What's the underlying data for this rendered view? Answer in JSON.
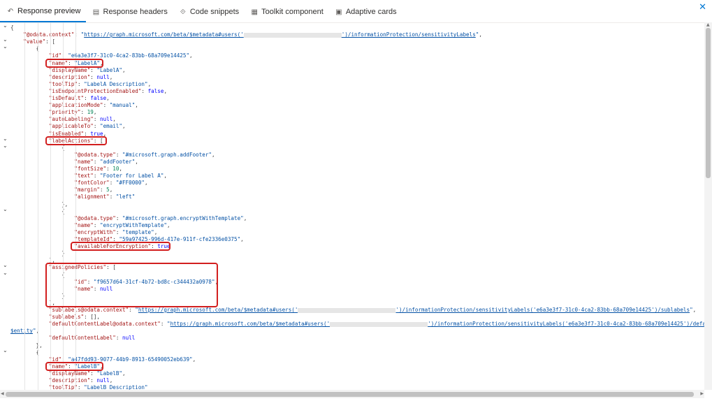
{
  "tabs": [
    {
      "label": "Response preview",
      "icon": "undo-arrow-icon"
    },
    {
      "label": "Response headers",
      "icon": "document-icon"
    },
    {
      "label": "Code snippets",
      "icon": "code-icon"
    },
    {
      "label": "Toolkit component",
      "icon": "toolkit-icon"
    },
    {
      "label": "Adaptive cards",
      "icon": "card-icon"
    }
  ],
  "close_glyph": "✕",
  "lines": [
    {
      "i": 0,
      "t": "{"
    },
    {
      "i": 4,
      "t": "\"@odata.context\": \"https://graph.microsoft.com/beta/$metadata#users('████████████████████')/informationProtection/sensitivityLabels\","
    },
    {
      "i": 4,
      "t": "\"value\": ["
    },
    {
      "i": 8,
      "t": "{"
    },
    {
      "i": 12,
      "t": "\"id\": \"e6a3e3f7-31c0-4ca2-83bb-68a709e14425\","
    },
    {
      "i": 12,
      "t": "\"name\": \"LabelA\","
    },
    {
      "i": 12,
      "t": "\"displayName\": \"LabelA\","
    },
    {
      "i": 12,
      "t": "\"description\": null,"
    },
    {
      "i": 12,
      "t": "\"toolTip\": \"LabelA Description\","
    },
    {
      "i": 12,
      "t": "\"isEndpointProtectionEnabled\": false,"
    },
    {
      "i": 12,
      "t": "\"isDefault\": false,"
    },
    {
      "i": 12,
      "t": "\"applicationMode\": \"manual\","
    },
    {
      "i": 12,
      "t": "\"priority\": 19,"
    },
    {
      "i": 12,
      "t": "\"autoLabeling\": null,"
    },
    {
      "i": 12,
      "t": "\"applicableTo\": \"email\","
    },
    {
      "i": 12,
      "t": "\"isEnabled\": true,"
    },
    {
      "i": 12,
      "t": "\"labelActions\": ["
    },
    {
      "i": 16,
      "t": "{"
    },
    {
      "i": 20,
      "t": "\"@odata.type\": \"#microsoft.graph.addFooter\","
    },
    {
      "i": 20,
      "t": "\"name\": \"addFooter\","
    },
    {
      "i": 20,
      "t": "\"fontSize\": 10,"
    },
    {
      "i": 20,
      "t": "\"text\": \"Footer for Label A\","
    },
    {
      "i": 20,
      "t": "\"fontColor\": \"#FF0000\","
    },
    {
      "i": 20,
      "t": "\"margin\": 5,"
    },
    {
      "i": 20,
      "t": "\"alignment\": \"left\""
    },
    {
      "i": 16,
      "t": "},"
    },
    {
      "i": 16,
      "t": "{"
    },
    {
      "i": 20,
      "t": "\"@odata.type\": \"#microsoft.graph.encryptWithTemplate\","
    },
    {
      "i": 20,
      "t": "\"name\": \"encryptWithTemplate\","
    },
    {
      "i": 20,
      "t": "\"encryptWith\": \"template\","
    },
    {
      "i": 20,
      "t": "\"templateId\": \"59a97425-996d-417e-911f-cfe2336e0375\","
    },
    {
      "i": 20,
      "t": "\"availableForEncryption\": true"
    },
    {
      "i": 16,
      "t": "}"
    },
    {
      "i": 12,
      "t": "],"
    },
    {
      "i": 12,
      "t": "\"assignedPolicies\": ["
    },
    {
      "i": 16,
      "t": "{"
    },
    {
      "i": 20,
      "t": "\"id\": \"f9657d64-31cf-4b72-bd8c-c344432a0978\","
    },
    {
      "i": 20,
      "t": "\"name\": null"
    },
    {
      "i": 16,
      "t": "}"
    },
    {
      "i": 12,
      "t": "],"
    },
    {
      "i": 12,
      "t": "\"sublabels@odata.context\": \"https://graph.microsoft.com/beta/$metadata#users('████████████████████')/informationProtection/sensitivityLabels('e6a3e3f7-31c0-4ca2-83bb-68a709e14425')/sublabels\","
    },
    {
      "i": 12,
      "t": "\"sublabels\": [],"
    },
    {
      "i": 12,
      "t": "\"defaultContentLabel@odata.context\": \"https://graph.microsoft.com/beta/$metadata#users('████████████████████')/informationProtection/sensitivityLabels('e6a3e3f7-31c0-4ca2-83bb-68a709e14425')/defaultContentLabel/"
    },
    {
      "i": 0,
      "t": "$entity\","
    },
    {
      "i": 12,
      "t": "\"defaultContentLabel\": null"
    },
    {
      "i": 8,
      "t": "},"
    },
    {
      "i": 8,
      "t": "{"
    },
    {
      "i": 12,
      "t": "\"id\": \"a47fdd93-9077-44b9-8913-65490052eb639\","
    },
    {
      "i": 12,
      "t": "\"name\": \"LabelB\","
    },
    {
      "i": 12,
      "t": "\"displayName\": \"LabelB\","
    },
    {
      "i": 12,
      "t": "\"description\": null,"
    },
    {
      "i": 12,
      "t": "\"toolTip\": \"LabelB Description\""
    }
  ],
  "redaction_marker": "████████████████████",
  "colors": {
    "accent": "#0078d4",
    "highlight": "#d21f1f",
    "key": "#a31515",
    "string": "#0451a5",
    "number": "#098658",
    "keyword": "#0000ff"
  }
}
